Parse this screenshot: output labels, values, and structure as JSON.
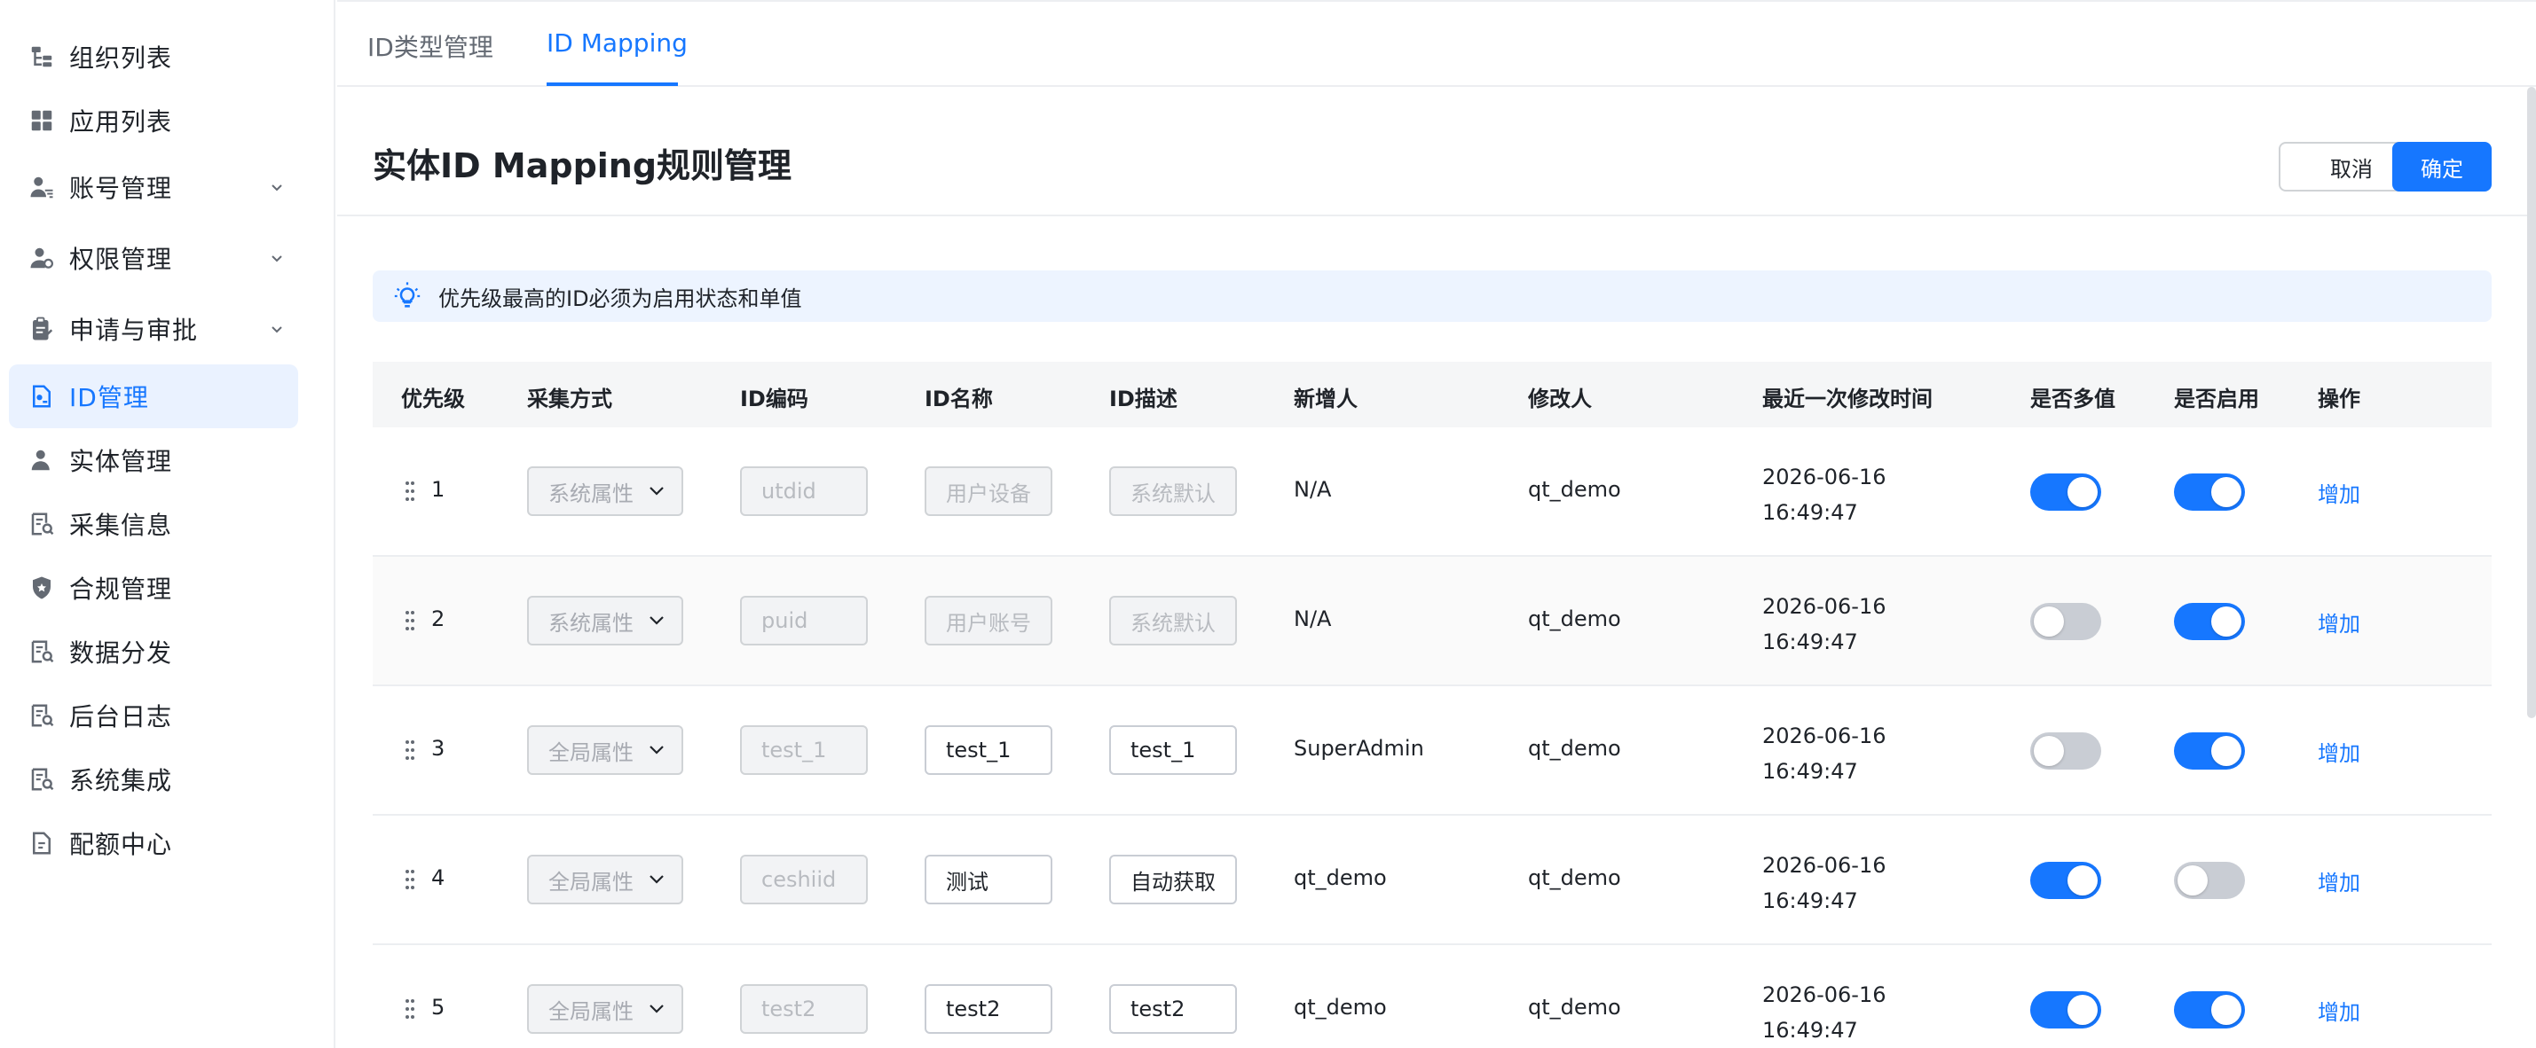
{
  "sidebar": {
    "items": [
      {
        "label": "组织列表",
        "icon": "org-tree-icon"
      },
      {
        "label": "应用列表",
        "icon": "app-grid-icon"
      },
      {
        "label": "账号管理",
        "icon": "user-account-icon",
        "expandable": true
      },
      {
        "label": "权限管理",
        "icon": "permission-icon",
        "expandable": true
      },
      {
        "label": "申请与审批",
        "icon": "clipboard-icon",
        "expandable": true
      },
      {
        "label": "ID管理",
        "icon": "id-doc-icon",
        "active": true
      },
      {
        "label": "实体管理",
        "icon": "person-icon"
      },
      {
        "label": "采集信息",
        "icon": "search-doc-icon"
      },
      {
        "label": "合规管理",
        "icon": "shield-icon"
      },
      {
        "label": "数据分发",
        "icon": "search-doc-icon"
      },
      {
        "label": "后台日志",
        "icon": "search-doc-icon"
      },
      {
        "label": "系统集成",
        "icon": "search-doc-icon"
      },
      {
        "label": "配额中心",
        "icon": "quota-doc-icon"
      }
    ]
  },
  "tabs": [
    {
      "label": "ID类型管理"
    },
    {
      "label": "ID Mapping",
      "active": true
    }
  ],
  "header": {
    "title": "实体ID Mapping规则管理",
    "cancel_label": "取消",
    "ok_label": "确定"
  },
  "notice": {
    "text": "优先级最高的ID必须为启用状态和单值",
    "icon": "lightbulb-icon"
  },
  "table": {
    "columns": [
      "优先级",
      "采集方式",
      "ID编码",
      "ID名称",
      "ID描述",
      "新增人",
      "修改人",
      "最近一次修改时间",
      "是否多值",
      "是否启用",
      "操作"
    ],
    "rows": [
      {
        "priority": "1",
        "collect": "系统属性",
        "code": "utdid",
        "name": "用户设备",
        "desc": "系统默认",
        "name_editable": false,
        "creator": "N/A",
        "modifier": "qt_demo",
        "date": "2026-06-16",
        "time": "16:49:47",
        "multi": true,
        "enabled": true,
        "action": "增加"
      },
      {
        "priority": "2",
        "collect": "系统属性",
        "code": "puid",
        "name": "用户账号",
        "desc": "系统默认",
        "name_editable": false,
        "creator": "N/A",
        "modifier": "qt_demo",
        "date": "2026-06-16",
        "time": "16:49:47",
        "multi": false,
        "enabled": true,
        "action": "增加"
      },
      {
        "priority": "3",
        "collect": "全局属性",
        "code": "test_1",
        "name": "test_1",
        "desc": "test_1",
        "name_editable": true,
        "creator": "SuperAdmin",
        "modifier": "qt_demo",
        "date": "2026-06-16",
        "time": "16:49:47",
        "multi": false,
        "enabled": true,
        "action": "增加"
      },
      {
        "priority": "4",
        "collect": "全局属性",
        "code": "ceshiid",
        "name": "测试",
        "desc": "自动获取",
        "name_editable": true,
        "creator": "qt_demo",
        "modifier": "qt_demo",
        "date": "2026-06-16",
        "time": "16:49:47",
        "multi": true,
        "enabled": false,
        "action": "增加"
      },
      {
        "priority": "5",
        "collect": "全局属性",
        "code": "test2",
        "name": "test2",
        "desc": "test2",
        "name_editable": true,
        "creator": "qt_demo",
        "modifier": "qt_demo",
        "date": "2026-06-16",
        "time": "16:49:47",
        "multi": true,
        "enabled": true,
        "action": "增加"
      }
    ]
  },
  "colors": {
    "accent": "#1677ff",
    "active_bg": "#eaf2ff",
    "notice_bg": "#edf4ff",
    "switch_off": "#c9cdd4"
  }
}
